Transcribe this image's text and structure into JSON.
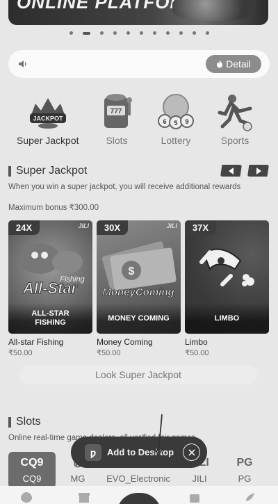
{
  "banner": {
    "title": "ONLINE PLATFORM"
  },
  "carousel": {
    "dot_count": 11,
    "active_index": 1
  },
  "notice": {
    "detail_label": "Detail"
  },
  "categories": [
    {
      "label": "Super Jackpot",
      "icon": "jackpot-icon",
      "active": true
    },
    {
      "label": "Slots",
      "icon": "slot-machine-icon",
      "active": false
    },
    {
      "label": "Lottery",
      "icon": "lottery-balls-icon",
      "active": false
    },
    {
      "label": "Sports",
      "icon": "sports-player-icon",
      "active": false
    }
  ],
  "super_jackpot": {
    "title": "Super Jackpot",
    "description": "When you win a super jackpot, you will receive additional rewards",
    "max_bonus": "Maximum bonus ₹300.00",
    "games": [
      {
        "multiplier": "24X",
        "brand": "JILI",
        "caption": "ALL-STAR\nFISHING",
        "name": "All-star Fishing",
        "price": "₹50.00"
      },
      {
        "multiplier": "30X",
        "brand": "JILI",
        "caption": "MONEY COMING",
        "name": "Money Coming",
        "price": "₹50.00"
      },
      {
        "multiplier": "37X",
        "brand": "",
        "caption": "LIMBO",
        "name": "Limbo",
        "price": "₹50.00"
      }
    ],
    "look_button": "Look Super Jackpot"
  },
  "slots": {
    "title": "Slots",
    "description": "Online real-time game dealers, all verified fair games",
    "providers": [
      {
        "logo": "CQ9",
        "label": "CQ9",
        "active": true
      },
      {
        "logo": "MG",
        "label": "MG",
        "active": false
      },
      {
        "logo": "EVO",
        "label": "EVO_Electronic",
        "active": false
      },
      {
        "logo": "JILI",
        "label": "JILI",
        "active": false
      },
      {
        "logo": "PG",
        "label": "PG",
        "active": false
      }
    ]
  },
  "add_to_desktop": {
    "label": "Add to Desktop"
  },
  "colors": {
    "background": "#e7e7e7",
    "accent": "#8c8c8c",
    "dark": "#3a3a3a"
  }
}
